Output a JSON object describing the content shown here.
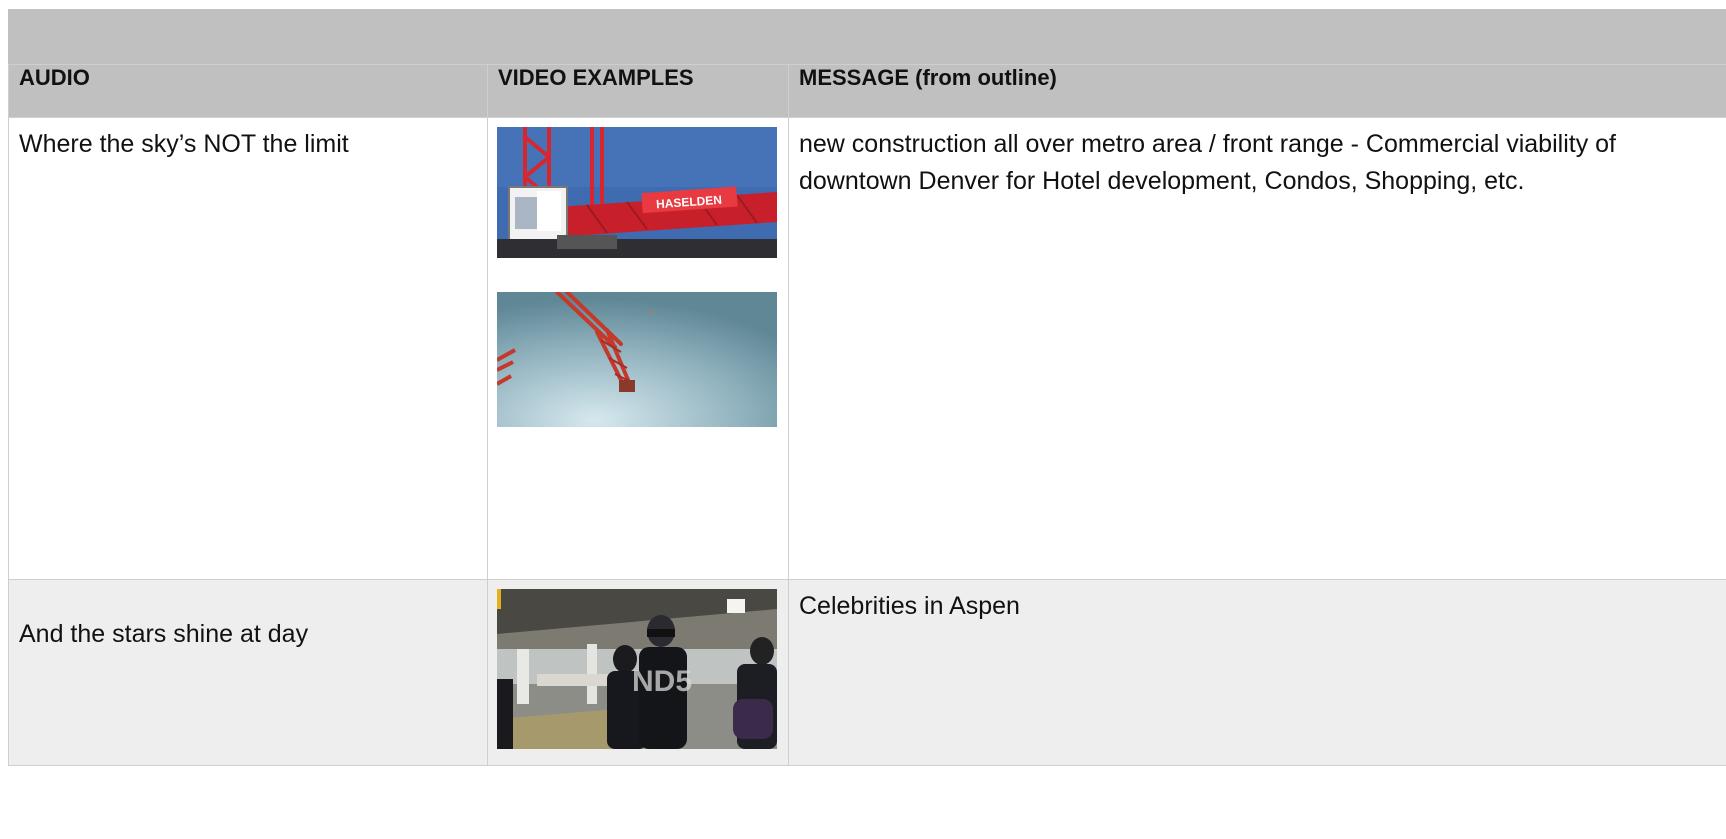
{
  "table": {
    "headers": {
      "audio": "AUDIO",
      "video": "VIDEO EXAMPLES",
      "message": "MESSAGE (from outline)"
    },
    "rows": [
      {
        "audio": "Where the sky’s NOT the limit",
        "message": "new construction all over metro area / front range - Commercial viability of downtown Denver for Hotel development, Condos, Shopping, etc.",
        "thumbnails": [
          {
            "subject": "crane-cab",
            "sign_text": "HASELDEN"
          },
          {
            "subject": "crane-boom-sky"
          }
        ]
      },
      {
        "audio": "And the stars shine at day",
        "message": "Celebrities in Aspen",
        "thumbnails": [
          {
            "subject": "celebrity-crowd",
            "overlay_text": "ND5"
          }
        ]
      }
    ]
  },
  "colors": {
    "header_bg": "#bfc0bf",
    "row_alt_bg": "#eeeeee",
    "crane_red": "#d8262e",
    "sky_blue": "#3f6bb0"
  }
}
